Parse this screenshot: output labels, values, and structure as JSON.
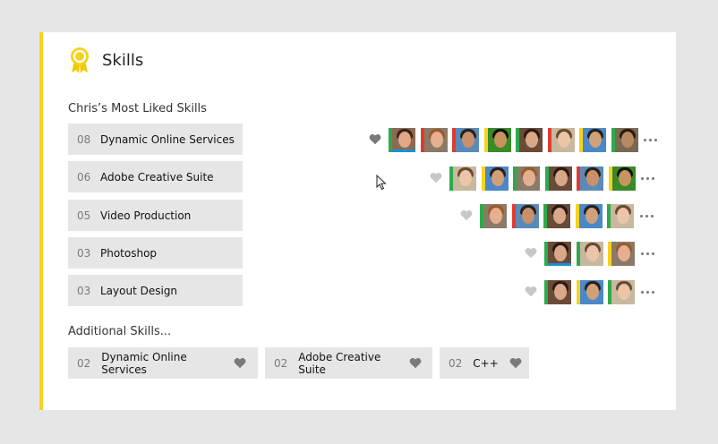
{
  "header": {
    "title": "Skills",
    "icon": "award-ribbon-icon",
    "accent": "#f7d21e"
  },
  "most_liked": {
    "label": "Chris’s Most Liked Skills",
    "items": [
      {
        "num": "08",
        "name": "Dynamic Online Services",
        "liked": true,
        "endorsers": 8
      },
      {
        "num": "06",
        "name": "Adobe Creative Suite",
        "liked": false,
        "endorsers": 6
      },
      {
        "num": "05",
        "name": "Video Production",
        "liked": false,
        "endorsers": 5
      },
      {
        "num": "03",
        "name": "Photoshop",
        "liked": false,
        "endorsers": 3
      },
      {
        "num": "03",
        "name": "Layout Design",
        "liked": false,
        "endorsers": 3
      }
    ]
  },
  "additional": {
    "label": "Additional Skills...",
    "items": [
      {
        "num": "02",
        "name": "Dynamic Online Services"
      },
      {
        "num": "02",
        "name": "Adobe Creative Suite"
      },
      {
        "num": "02",
        "name": "C++"
      }
    ]
  },
  "colors": {
    "selected_underline": "#1b8fd6",
    "heart_active": "#7a7a7a",
    "heart_inactive": "#c8c8c8"
  }
}
